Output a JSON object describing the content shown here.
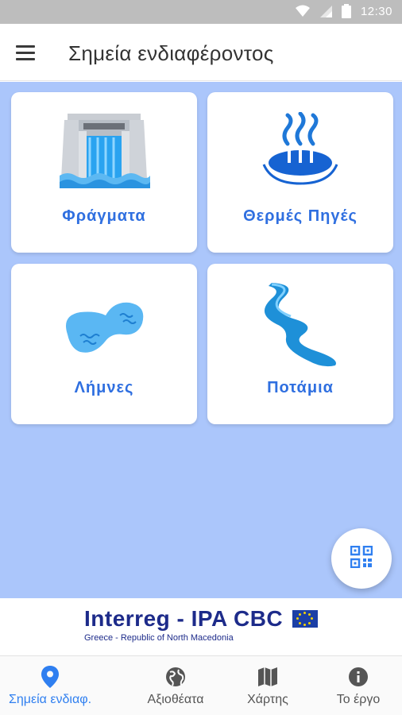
{
  "status_bar": {
    "time": "12:30",
    "icons": [
      "wifi-icon",
      "signal-icon",
      "battery-icon"
    ]
  },
  "app_bar": {
    "menu_icon": "hamburger-menu-icon",
    "title": "Σημεία ενδιαφέροντος"
  },
  "cards": [
    {
      "label": "Φράγματα",
      "icon": "dam-icon"
    },
    {
      "label": "Θερμές Πηγές",
      "icon": "hot-spring-icon"
    },
    {
      "label": "Λήμνες",
      "icon": "lake-icon"
    },
    {
      "label": "Ποτάμια",
      "icon": "river-icon"
    }
  ],
  "fab": {
    "icon": "qr-code-icon"
  },
  "banner": {
    "title": "Interreg - IPA CBC",
    "subtitle": "Greece - Republic of North Macedonia",
    "flag_icon": "eu-flag-icon"
  },
  "bottom_nav": [
    {
      "label": "Σημεία ενδιαφ.",
      "icon": "location-pin-icon",
      "active": true
    },
    {
      "label": "Αξιοθέατα",
      "icon": "globe-icon",
      "active": false
    },
    {
      "label": "Χάρτης",
      "icon": "map-icon",
      "active": false
    },
    {
      "label": "Το έργο",
      "icon": "info-icon",
      "active": false
    }
  ],
  "colors": {
    "accent": "#2f7ff0",
    "card_label": "#2f6fe0",
    "background": "#abc6fb",
    "status_bar": "#bdbdbd"
  }
}
